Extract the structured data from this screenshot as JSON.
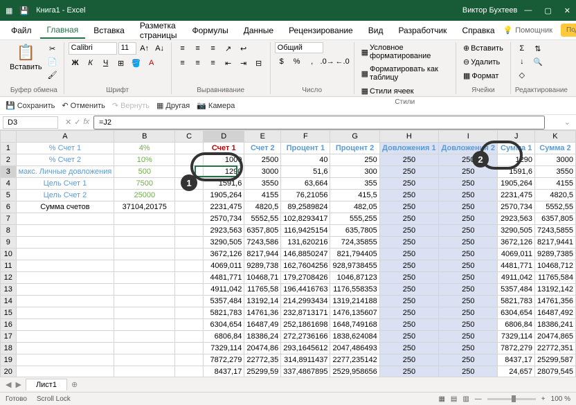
{
  "title": "Книга1 - Excel",
  "user": "Виктор Бухтеев",
  "menu": [
    "Файл",
    "Главная",
    "Вставка",
    "Разметка страницы",
    "Формулы",
    "Данные",
    "Рецензирование",
    "Вид",
    "Разработчик",
    "Справка"
  ],
  "active_menu": 1,
  "assistant": "Помощник",
  "publish": "Поделиться",
  "font": {
    "name": "Calibri",
    "size": "11"
  },
  "numfmt": "Общий",
  "groups": {
    "clipboard": "Буфер обмена",
    "font": "Шрифт",
    "align": "Выравнивание",
    "number": "Число",
    "styles": "Стили",
    "cells": "Ячейки",
    "editing": "Редактирование"
  },
  "paste": "Вставить",
  "styles": {
    "cond": "Условное форматирование",
    "table": "Форматировать как таблицу",
    "cells": "Стили ячеек"
  },
  "cells": {
    "insert": "Вставить",
    "delete": "Удалить",
    "format": "Формат"
  },
  "qat": {
    "save": "Сохранить",
    "undo": "Отменить",
    "redo": "Вернуть",
    "other": "Другая",
    "camera": "Камера"
  },
  "namebox": "D3",
  "formula": "=J2",
  "cols": [
    "A",
    "B",
    "C",
    "D",
    "E",
    "F",
    "G",
    "H",
    "I",
    "J",
    "K"
  ],
  "rows_a": {
    "1": "% Счет 1",
    "2": "% Счет 2",
    "3": "макс. Личные довложения",
    "4": "Цель Счет 1",
    "5": "Цель Счет 2",
    "6": "Сумма счетов"
  },
  "rows_b": {
    "1": "4%",
    "2": "10%",
    "3": "500",
    "4": "7500",
    "5": "25000",
    "6": "37104,20175"
  },
  "hdr": {
    "D": "Счет 1",
    "E": "Счет 2",
    "F": "Процент 1",
    "G": "Процент 2",
    "H": "Довложения 1",
    "I": "Довложения 2",
    "J": "Сумма 1",
    "K": "Сумма 2"
  },
  "data": [
    {
      "r": 2,
      "D": "1000",
      "E": "2500",
      "F": "40",
      "G": "250",
      "H": "250",
      "I": "250",
      "J": "1290",
      "K": "3000"
    },
    {
      "r": 3,
      "D": "1290",
      "E": "3000",
      "F": "51,6",
      "G": "300",
      "H": "250",
      "I": "250",
      "J": "1591,6",
      "K": "3550"
    },
    {
      "r": 4,
      "D": "1591,6",
      "E": "3550",
      "F": "63,664",
      "G": "355",
      "H": "250",
      "I": "250",
      "J": "1905,264",
      "K": "4155"
    },
    {
      "r": 5,
      "D": "1905,264",
      "E": "4155",
      "F": "76,21056",
      "G": "415,5",
      "H": "250",
      "I": "250",
      "J": "2231,475",
      "K": "4820,5"
    },
    {
      "r": 6,
      "D": "2231,475",
      "E": "4820,5",
      "F": "89,2589824",
      "G": "482,05",
      "H": "250",
      "I": "250",
      "J": "2570,734",
      "K": "5552,55"
    },
    {
      "r": 7,
      "D": "2570,734",
      "E": "5552,55",
      "F": "102,8293417",
      "G": "555,255",
      "H": "250",
      "I": "250",
      "J": "2923,563",
      "K": "6357,805"
    },
    {
      "r": 8,
      "D": "2923,563",
      "E": "6357,805",
      "F": "116,9425154",
      "G": "635,7805",
      "H": "250",
      "I": "250",
      "J": "3290,505",
      "K": "7243,5855"
    },
    {
      "r": 9,
      "D": "3290,505",
      "E": "7243,586",
      "F": "131,620216",
      "G": "724,35855",
      "H": "250",
      "I": "250",
      "J": "3672,126",
      "K": "8217,9441"
    },
    {
      "r": 10,
      "D": "3672,126",
      "E": "8217,944",
      "F": "146,8850247",
      "G": "821,794405",
      "H": "250",
      "I": "250",
      "J": "4069,011",
      "K": "9289,7385"
    },
    {
      "r": 11,
      "D": "4069,011",
      "E": "9289,738",
      "F": "162,7604256",
      "G": "928,9738455",
      "H": "250",
      "I": "250",
      "J": "4481,771",
      "K": "10468,712"
    },
    {
      "r": 12,
      "D": "4481,771",
      "E": "10468,71",
      "F": "179,2708426",
      "G": "1046,87123",
      "H": "250",
      "I": "250",
      "J": "4911,042",
      "K": "11765,584"
    },
    {
      "r": 13,
      "D": "4911,042",
      "E": "11765,58",
      "F": "196,4416763",
      "G": "1176,558353",
      "H": "250",
      "I": "250",
      "J": "5357,484",
      "K": "13192,142"
    },
    {
      "r": 14,
      "D": "5357,484",
      "E": "13192,14",
      "F": "214,2993434",
      "G": "1319,214188",
      "H": "250",
      "I": "250",
      "J": "5821,783",
      "K": "14761,356"
    },
    {
      "r": 15,
      "D": "5821,783",
      "E": "14761,36",
      "F": "232,8713171",
      "G": "1476,135607",
      "H": "250",
      "I": "250",
      "J": "6304,654",
      "K": "16487,492"
    },
    {
      "r": 16,
      "D": "6304,654",
      "E": "16487,49",
      "F": "252,1861698",
      "G": "1648,749168",
      "H": "250",
      "I": "250",
      "J": "6806,84",
      "K": "18386,241"
    },
    {
      "r": 17,
      "D": "6806,84",
      "E": "18386,24",
      "F": "272,2736166",
      "G": "1838,624084",
      "H": "250",
      "I": "250",
      "J": "7329,114",
      "K": "20474,865"
    },
    {
      "r": 18,
      "D": "7329,114",
      "E": "20474,86",
      "F": "293,1645612",
      "G": "2047,486493",
      "H": "250",
      "I": "250",
      "J": "7872,279",
      "K": "22772,351"
    },
    {
      "r": 19,
      "D": "7872,279",
      "E": "22772,35",
      "F": "314,8911437",
      "G": "2277,235142",
      "H": "250",
      "I": "250",
      "J": "8437,17",
      "K": "25299,587"
    },
    {
      "r": 20,
      "D": "8437,17",
      "E": "25299,59",
      "F": "337,4867895",
      "G": "2529,958656",
      "H": "250",
      "I": "250",
      "J": "24,657",
      "K": "28079,545"
    }
  ],
  "sheet": "Лист1",
  "status": {
    "ready": "Готово",
    "scroll": "Scroll Lock",
    "zoom": "100 %"
  },
  "chart_data": null
}
